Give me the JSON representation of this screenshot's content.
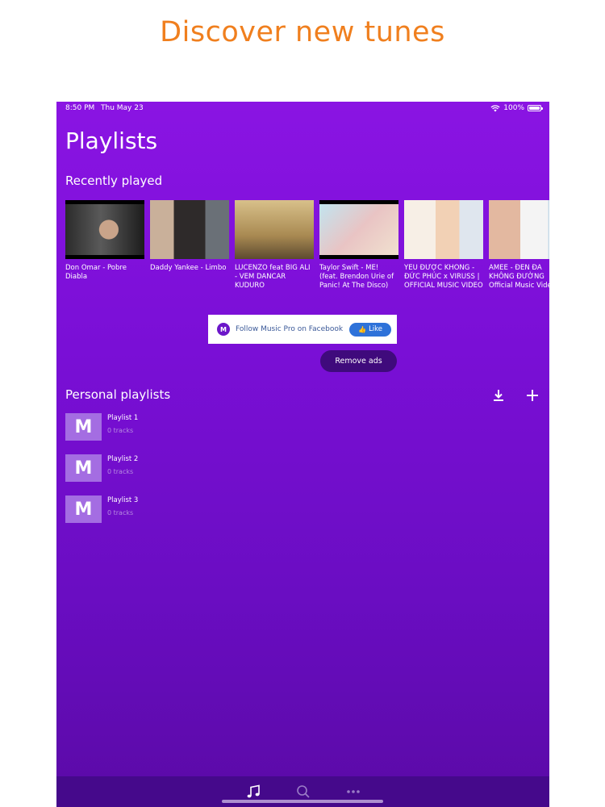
{
  "headline": "Discover new tunes",
  "status": {
    "time": "8:50 PM",
    "date": "Thu May 23",
    "battery": "100%"
  },
  "page_title": "Playlists",
  "recently_played": {
    "title": "Recently played",
    "items": [
      {
        "title": "Don Omar - Pobre Diabla"
      },
      {
        "title": "Daddy Yankee - Limbo"
      },
      {
        "title": "LUCENZO feat BIG ALI - VEM DANCAR KUDURO"
      },
      {
        "title": "Taylor Swift - ME! (feat. Brendon Urie of Panic! At The Disco)"
      },
      {
        "title": "YÊU ĐƯỢC KHÔNG - ĐỨC PHÚC x VIRUSS | OFFICIAL MUSIC VIDEO"
      },
      {
        "title": "AMEE - ĐEN ĐÁ KHÔNG ĐƯỜNG Official Music Video"
      }
    ]
  },
  "facebook_banner": {
    "logo_letter": "M",
    "text": "Follow Music Pro on Facebook",
    "like_label": "Like"
  },
  "remove_ads_label": "Remove ads",
  "personal_playlists": {
    "title": "Personal playlists",
    "items": [
      {
        "cover_letter": "M",
        "name": "Playlist 1",
        "tracks": "0 tracks"
      },
      {
        "cover_letter": "M",
        "name": "Playlist 2",
        "tracks": "0 tracks"
      },
      {
        "cover_letter": "M",
        "name": "Playlist 3",
        "tracks": "0 tracks"
      }
    ]
  },
  "tabs": [
    {
      "icon": "music-note-icon",
      "active": true
    },
    {
      "icon": "search-icon",
      "active": false
    },
    {
      "icon": "more-icon",
      "active": false
    }
  ],
  "colors": {
    "headline": "#f07f1e",
    "background_top": "#8a14e3",
    "background_bottom": "#5a0aa6",
    "accent_button": "#3f0a7c",
    "facebook_like": "#2e72d9"
  }
}
